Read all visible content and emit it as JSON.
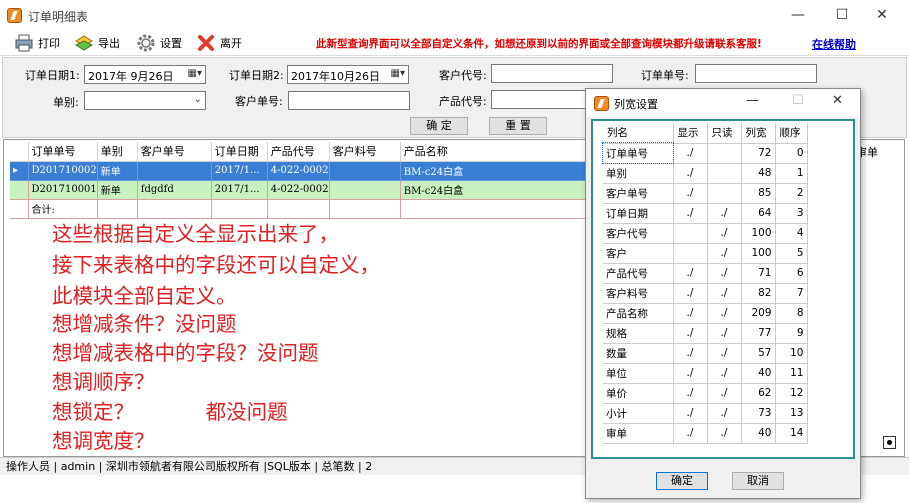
{
  "window": {
    "title": "订单明细表",
    "minimize": "—",
    "maximize": "☐",
    "close": "✕"
  },
  "toolbar": {
    "print": "打印",
    "export": "导出",
    "settings": "设置",
    "leave": "离开",
    "notice": "此新型查询界面可以全部自定义条件，如想还原到以前的界面或全部查询模块都升级请联系客服!",
    "help": "在线帮助"
  },
  "filters": {
    "date1_label": "订单日期1:",
    "date1_value": "2017年 9月26日",
    "date2_label": "订单日期2:",
    "date2_value": "2017年10月26日",
    "customer_code_label": "客户代号:",
    "order_no_label": "订单单号:",
    "type_label": "单别:",
    "customer_order_label": "客户单号:",
    "product_code_label": "产品代号:",
    "confirm": "确  定",
    "reset": "重  置"
  },
  "grid": {
    "columns": [
      "订单单号",
      "单别",
      "客户单号",
      "订单日期",
      "产品代号",
      "客户料号",
      "产品名称"
    ],
    "right_header": "审单",
    "rows": [
      [
        "D201710002",
        "新单",
        "",
        "2017/1...",
        "4-022-0002",
        "",
        "BM-c24白盒"
      ],
      [
        "D201710001",
        "新单",
        "fdgdfd",
        "2017/1...",
        "4-022-0002",
        "",
        "BM-c24白盒"
      ]
    ],
    "total_label": "合计:"
  },
  "annotation": [
    "这些根据自定义全显示出来了，",
    "接下来表格中的字段还可以自定义，",
    "此模块全部自定义。",
    "想增减条件？没问题",
    "想增减表格中的字段？没问题",
    "想调顺序？",
    "想锁定？           都没问题",
    "想调宽度？"
  ],
  "status": {
    "text": "操作人员  | admin | 深圳市领航者有限公司版权所有   |SQL版本     | 总笔数 |   2"
  },
  "dialog": {
    "title": "列宽设置",
    "headers": [
      "列名",
      "显示",
      "只读",
      "列宽",
      "顺序"
    ],
    "rows": [
      [
        "订单单号",
        "./",
        "",
        "72",
        "0"
      ],
      [
        "单别",
        "./",
        "",
        "48",
        "1"
      ],
      [
        "客户单号",
        "./",
        "",
        "85",
        "2"
      ],
      [
        "订单日期",
        "./",
        "./",
        "64",
        "3"
      ],
      [
        "客户代号",
        "",
        "./",
        "100",
        "4"
      ],
      [
        "客户",
        "",
        "./",
        "100",
        "5"
      ],
      [
        "产品代号",
        "./",
        "./",
        "71",
        "6"
      ],
      [
        "客户料号",
        "./",
        "./",
        "82",
        "7"
      ],
      [
        "产品名称",
        "./",
        "./",
        "209",
        "8"
      ],
      [
        "规格",
        "./",
        "./",
        "77",
        "9"
      ],
      [
        "数量",
        "./",
        "./",
        "57",
        "10"
      ],
      [
        "单位",
        "./",
        "./",
        "40",
        "11"
      ],
      [
        "单价",
        "./",
        "./",
        "62",
        "12"
      ],
      [
        "小计",
        "./",
        "./",
        "73",
        "13"
      ],
      [
        "审单",
        "./",
        "./",
        "40",
        "14"
      ]
    ],
    "ok": "确定",
    "cancel": "取消"
  }
}
